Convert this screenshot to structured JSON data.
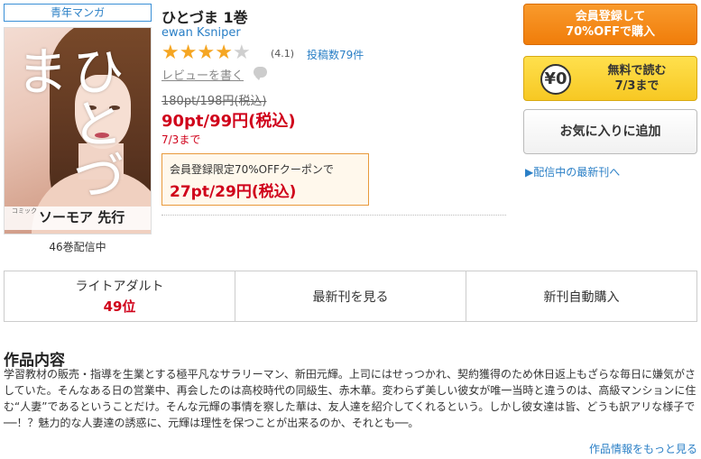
{
  "genre_tag": "青年マンガ",
  "cover": {
    "title_art": "ひとづま",
    "band_text": "ソーモア 先行",
    "band_sub": "コミック"
  },
  "volumes_count": "46巻配信中",
  "book": {
    "title": "ひとづま 1巻",
    "author": "ewan Ksniper",
    "rating_stars": 4.1,
    "rating_value": "(4.1)",
    "review_count": "投稿数79件",
    "write_review": "レビューを書く"
  },
  "price": {
    "original": "180pt/198円(税込)",
    "sale": "90pt/99円(税込)",
    "sale_until": "7/3まで"
  },
  "coupon": {
    "label": "会員登録限定70%OFFクーポンで",
    "price": "27pt/29円(税込)"
  },
  "buttons": {
    "register_line1": "会員登録して",
    "register_line2": "70%OFFで購入",
    "free_icon": "¥0",
    "free_line1": "無料で読む",
    "free_line2": "7/3まで",
    "favorite": "お気に入りに追加"
  },
  "latest_link": "▶配信中の最新刊へ",
  "tabs": [
    {
      "label": "ライトアダルト",
      "rank": "49位"
    },
    {
      "label": "最新刊を見る"
    },
    {
      "label": "新刊自動購入"
    }
  ],
  "section_title": "作品内容",
  "synopsis": "学習教材の販売・指導を生業とする極平凡なサラリーマン、新田元輝。上司にはせっつかれ、契約獲得のため休日返上もざらな毎日に嫌気がさしていた。そんなある日の営業中、再会したのは高校時代の同級生、赤木華。変わらず美しい彼女が唯一当時と違うのは、高級マンションに住む“人妻”であるということだけ。そんな元輝の事情を察した華は、友人達を紹介してくれるという。しかし彼女達は皆、どうも訳アリな様子で──！？魅力的な人妻達の誘惑に、元輝は理性を保つことが出来るのか、それとも──。",
  "more_info": "作品情報をもっと見る",
  "colors": {
    "accent_blue": "#2a7fc6",
    "price_red": "#d0021b",
    "star_orange": "#f5a623",
    "register_orange": "#f07d0a",
    "free_yellow": "#f7c823"
  }
}
